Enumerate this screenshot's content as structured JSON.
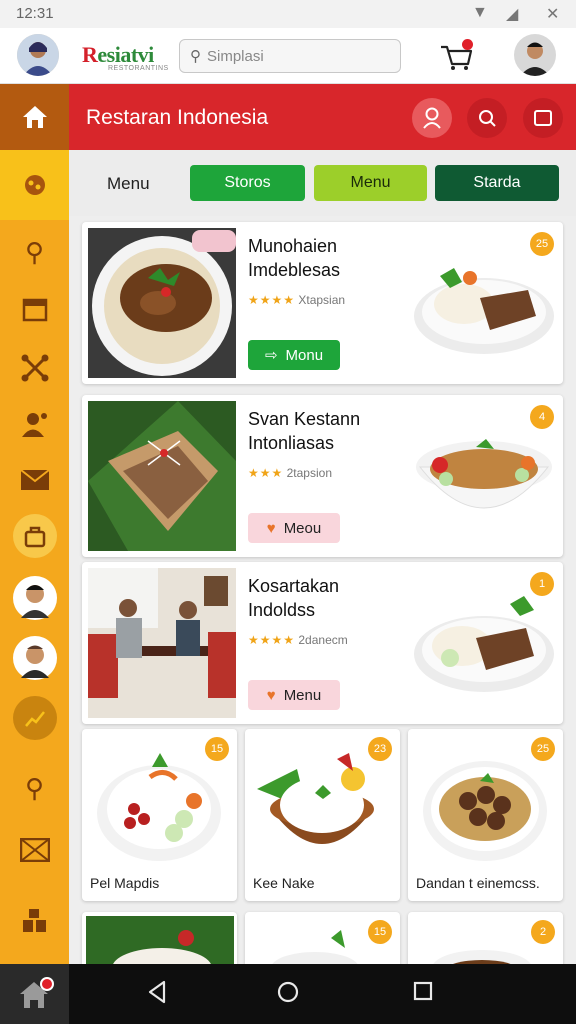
{
  "status": {
    "time": "12:31"
  },
  "header": {
    "brand": "Resiatvi",
    "brand_sub": "RESTORANTINS",
    "search_placeholder": "Simplasi"
  },
  "titlebar": {
    "title": "Restaran Indonesia"
  },
  "tabs": [
    {
      "label": "Menu",
      "style": "plain"
    },
    {
      "label": "Storos",
      "bg": "#1ea53a",
      "fg": "#ffffff"
    },
    {
      "label": "Menu",
      "bg": "#9ccf2a",
      "fg": "#1a2a0a"
    },
    {
      "label": "Starda",
      "bg": "#0f5a33",
      "fg": "#ffffff"
    }
  ],
  "cards": [
    {
      "line1": "Munohaien",
      "line2": "Imdeblesas",
      "stars": "★★★★",
      "rating_text": "Xtapsian",
      "button": "Monu",
      "button_style": "green",
      "badge": "25"
    },
    {
      "line1": "Svan Kestann",
      "line2": "Intonliasas",
      "stars": "★★★",
      "rating_text": "2tapsion",
      "button": "Meou",
      "button_style": "pink",
      "badge": "4"
    },
    {
      "line1": "Kosartakan",
      "line2": "Indoldss",
      "stars": "★★★★",
      "rating_text": "2danecm",
      "button": "Menu",
      "button_style": "pink",
      "badge": "1"
    }
  ],
  "tiles": [
    {
      "label": "Pel Mapdis",
      "badge": "15"
    },
    {
      "label": "Kee Nake",
      "badge": "23"
    },
    {
      "label": "Dandan t einemcss.",
      "badge": "25"
    }
  ],
  "peek_badges": [
    "15",
    "2"
  ],
  "colors": {
    "accent_red": "#d8262b",
    "rail_orange": "#f4a81d",
    "rail_dark": "#b35a10",
    "badge_orange": "#f4a81d",
    "green_button": "#1ea53a"
  }
}
